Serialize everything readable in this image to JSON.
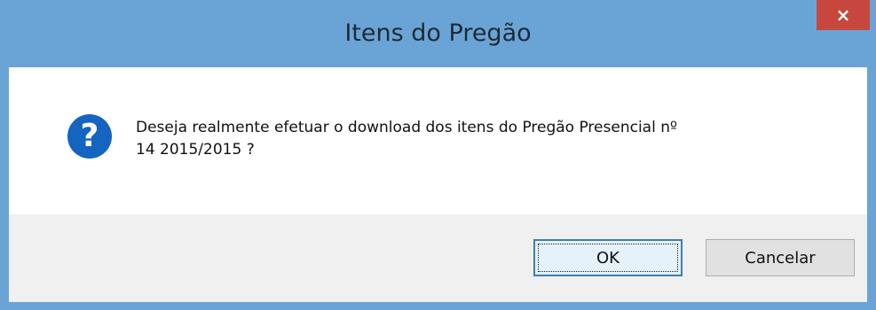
{
  "dialog": {
    "title": "Itens do Pregão",
    "close_label": "×",
    "icon": "question-icon",
    "icon_glyph": "?",
    "message_line1": "Deseja realmente efetuar o download dos itens do Pregão Presencial nº",
    "message_line2": "14 2015/2015 ?",
    "buttons": {
      "ok": "OK",
      "cancel": "Cancelar"
    }
  },
  "colors": {
    "titlebar": "#6aa4d6",
    "close": "#c7473e",
    "icon": "#1565c0",
    "footer": "#f0f0f0"
  }
}
